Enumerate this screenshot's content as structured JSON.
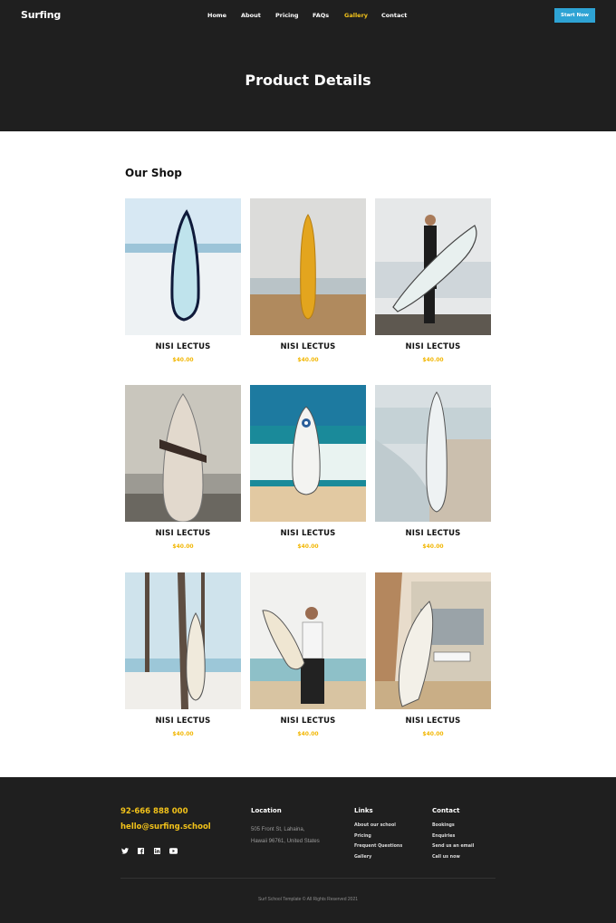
{
  "header": {
    "logo": "Surfing",
    "nav": [
      {
        "label": "Home",
        "active": false
      },
      {
        "label": "About",
        "active": false
      },
      {
        "label": "Pricing",
        "active": false
      },
      {
        "label": "FAQs",
        "active": false
      },
      {
        "label": "Gallery",
        "active": true
      },
      {
        "label": "Contact",
        "active": false
      }
    ],
    "cta_label": "Start Now",
    "page_title": "Product Details"
  },
  "shop": {
    "heading": "Our Shop",
    "products": [
      {
        "name": "NISI LECTUS",
        "price": "$40.00"
      },
      {
        "name": "NISI LECTUS",
        "price": "$40.00"
      },
      {
        "name": "NISI LECTUS",
        "price": "$40.00"
      },
      {
        "name": "NISI LECTUS",
        "price": "$40.00"
      },
      {
        "name": "NISI LECTUS",
        "price": "$40.00"
      },
      {
        "name": "NISI LECTUS",
        "price": "$40.00"
      },
      {
        "name": "NISI LECTUS",
        "price": "$40.00"
      },
      {
        "name": "NISI LECTUS",
        "price": "$40.00"
      },
      {
        "name": "NISI LECTUS",
        "price": "$40.00"
      }
    ]
  },
  "footer": {
    "phone": "92-666 888 000",
    "email": "hello@surfing.school",
    "location_title": "Location",
    "address_line1": "505 Front St, Lahaina,",
    "address_line2": "Hawaii 96761, United States",
    "links_title": "Links",
    "links": [
      "About our school",
      "Pricing",
      "Frequent Questions",
      "Gallery"
    ],
    "contact_title": "Contact",
    "contact": [
      "Bookings",
      "Enquiries",
      "Send us an email",
      "Call us now"
    ],
    "copyright": "Surf School Template  © All Rights Reserved 2021"
  },
  "colors": {
    "dark_bg": "#1f1f1f",
    "accent_yellow": "#f2c21a",
    "cta_blue": "#2ea3d4",
    "price_yellow": "#f2b705"
  }
}
